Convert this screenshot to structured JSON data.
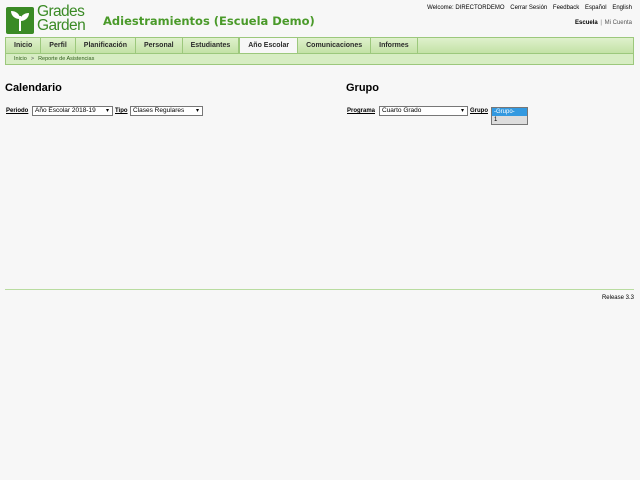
{
  "brand": {
    "logo_line1": "Grades",
    "logo_line2": "Garden",
    "school": "Adiestramientos (Escuela Demo)"
  },
  "toplinks": {
    "welcome": "Welcome: DIRECTORDEMO",
    "logout": "Cerrar Sesión",
    "feedback": "Feedback",
    "spanish": "Español",
    "english": "English"
  },
  "account": {
    "school": "Escuela",
    "separator": "|",
    "my_account": "Mi Cuenta"
  },
  "nav": {
    "items": [
      "Inicio",
      "Perfil",
      "Planificación",
      "Personal",
      "Estudiantes",
      "Año Escolar",
      "Comunicaciones",
      "Informes"
    ],
    "active": "Año Escolar"
  },
  "breadcrumb": {
    "home": "Inicio",
    "separator": ">",
    "current": "Reporte de Asistencias"
  },
  "calendar": {
    "title": "Calendario",
    "period_label": "Periodo",
    "period_value": "Año Escolar 2018-19",
    "type_label": "Tipo",
    "type_value": "Clases Regulares"
  },
  "group": {
    "title": "Grupo",
    "program_label": "Programa",
    "program_value": "Cuarto Grado",
    "group_label": "Grupo",
    "group_options": [
      "-Grupo-",
      "1"
    ]
  },
  "footer": {
    "release": "Release 3.3"
  },
  "colors": {
    "brand_green": "#3a8a25",
    "nav_bg": "#c3e2a6",
    "select_highlight": "#3399e0"
  }
}
